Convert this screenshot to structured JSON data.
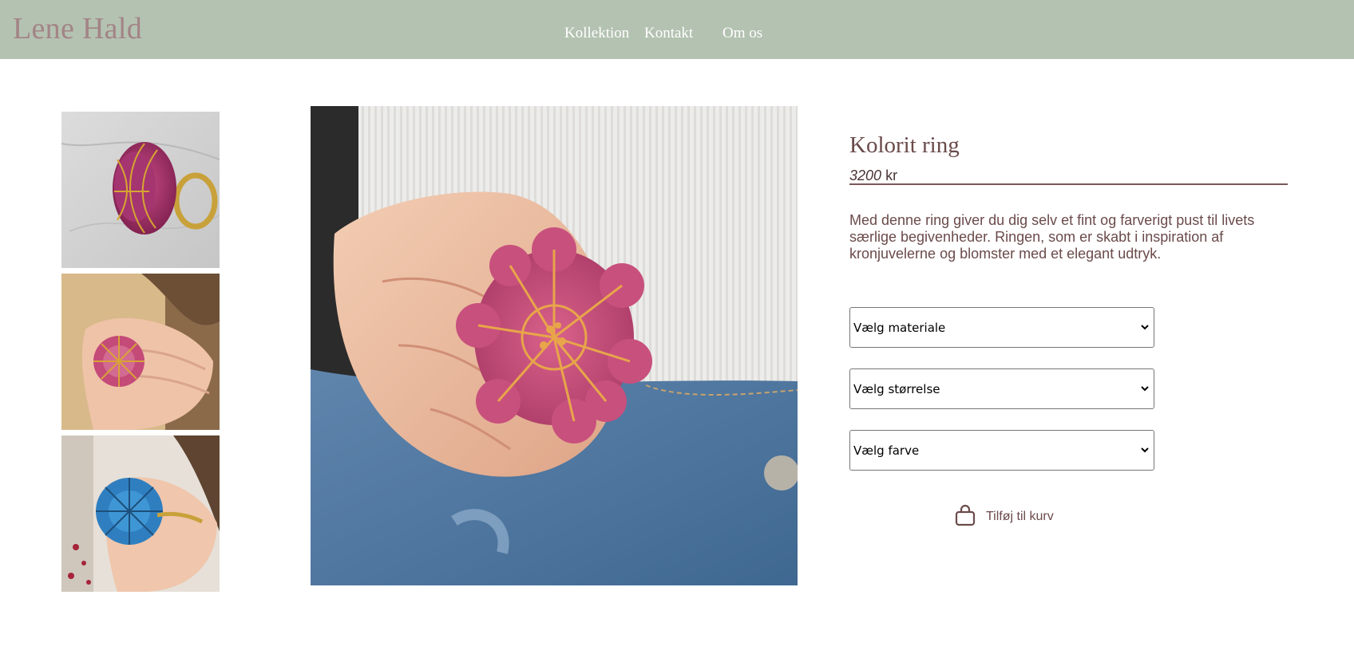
{
  "brand": {
    "name": "Lene Hald"
  },
  "nav": {
    "items": [
      {
        "label": "Kollektion"
      },
      {
        "label": "Kontakt"
      },
      {
        "label": "Om os"
      }
    ]
  },
  "gallery": {
    "thumbnails": [
      {
        "alt": "Pink ring on marble"
      },
      {
        "alt": "Pink ring worn on hand"
      },
      {
        "alt": "Blue ring worn on hand"
      }
    ],
    "main_image": {
      "alt": "Kolorit ring worn on hand"
    }
  },
  "product": {
    "title": "Kolorit ring",
    "price_amount": "3200",
    "price_currency": "kr",
    "description": "Med denne ring giver du dig selv et fint og farverigt pust til livets særlige begivenheder. Ringen, som er skabt i inspiration af kronjuvelerne og blomster med et elegant udtryk."
  },
  "options": {
    "material": "Vælg materiale",
    "size": "Vælg størrelse",
    "color": "Vælg farve"
  },
  "cart": {
    "label": "Tilføj til kurv",
    "icon": "shopping-bag-icon"
  },
  "colors": {
    "header_bg": "#b4c2b1",
    "logo": "#a38486",
    "text_primary": "#6b4a4a",
    "accent_rule": "#7a5858"
  }
}
